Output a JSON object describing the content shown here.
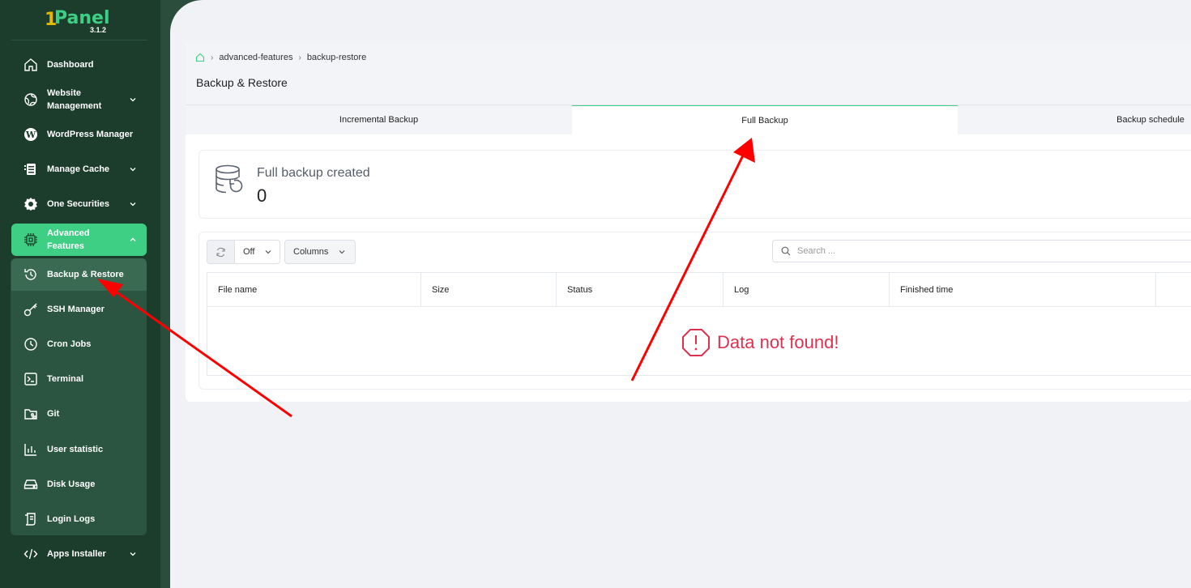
{
  "app": {
    "logo": "Panel",
    "logo_mark": "1",
    "version": "3.1.2"
  },
  "sidebar": {
    "items": [
      {
        "label": "Dashboard",
        "icon": "home-icon"
      },
      {
        "label": "Website\nManagement",
        "icon": "globe-icon"
      },
      {
        "label": "WordPress Manager",
        "icon": "wordpress-icon"
      },
      {
        "label": "Manage Cache",
        "icon": "cache-icon"
      },
      {
        "label": "One Securities",
        "icon": "gear-shield-icon"
      },
      {
        "label": "Advanced\nFeatures",
        "icon": "chip-icon"
      },
      {
        "label": "Apps Installer",
        "icon": "code-icon"
      }
    ],
    "submenu": [
      {
        "label": "Backup & Restore",
        "icon": "history-icon"
      },
      {
        "label": "SSH Manager",
        "icon": "key-icon"
      },
      {
        "label": "Cron Jobs",
        "icon": "clock-icon"
      },
      {
        "label": "Terminal",
        "icon": "terminal-icon"
      },
      {
        "label": "Git",
        "icon": "git-folder-icon"
      },
      {
        "label": "User statistic",
        "icon": "bar-chart-icon"
      },
      {
        "label": "Disk Usage",
        "icon": "disk-icon"
      },
      {
        "label": "Login Logs",
        "icon": "log-icon"
      }
    ]
  },
  "breadcrumb": {
    "items": [
      "advanced-features",
      "backup-restore"
    ]
  },
  "page": {
    "title": "Backup & Restore"
  },
  "tabs": [
    {
      "label": "Incremental Backup"
    },
    {
      "label": "Full Backup"
    },
    {
      "label": "Backup schedule"
    }
  ],
  "stat": {
    "label": "Full backup created",
    "value": "0"
  },
  "toolbar": {
    "refresh_value": "Off",
    "columns_label": "Columns",
    "search_placeholder": "Search ..."
  },
  "table": {
    "columns": [
      "File name",
      "Size",
      "Status",
      "Log",
      "Finished time"
    ],
    "empty_text": "Data not found!"
  },
  "colors": {
    "accent": "#3ecf84",
    "sidebar": "#1c3d2c",
    "error": "#e03050",
    "annotation": "#ff0000"
  }
}
